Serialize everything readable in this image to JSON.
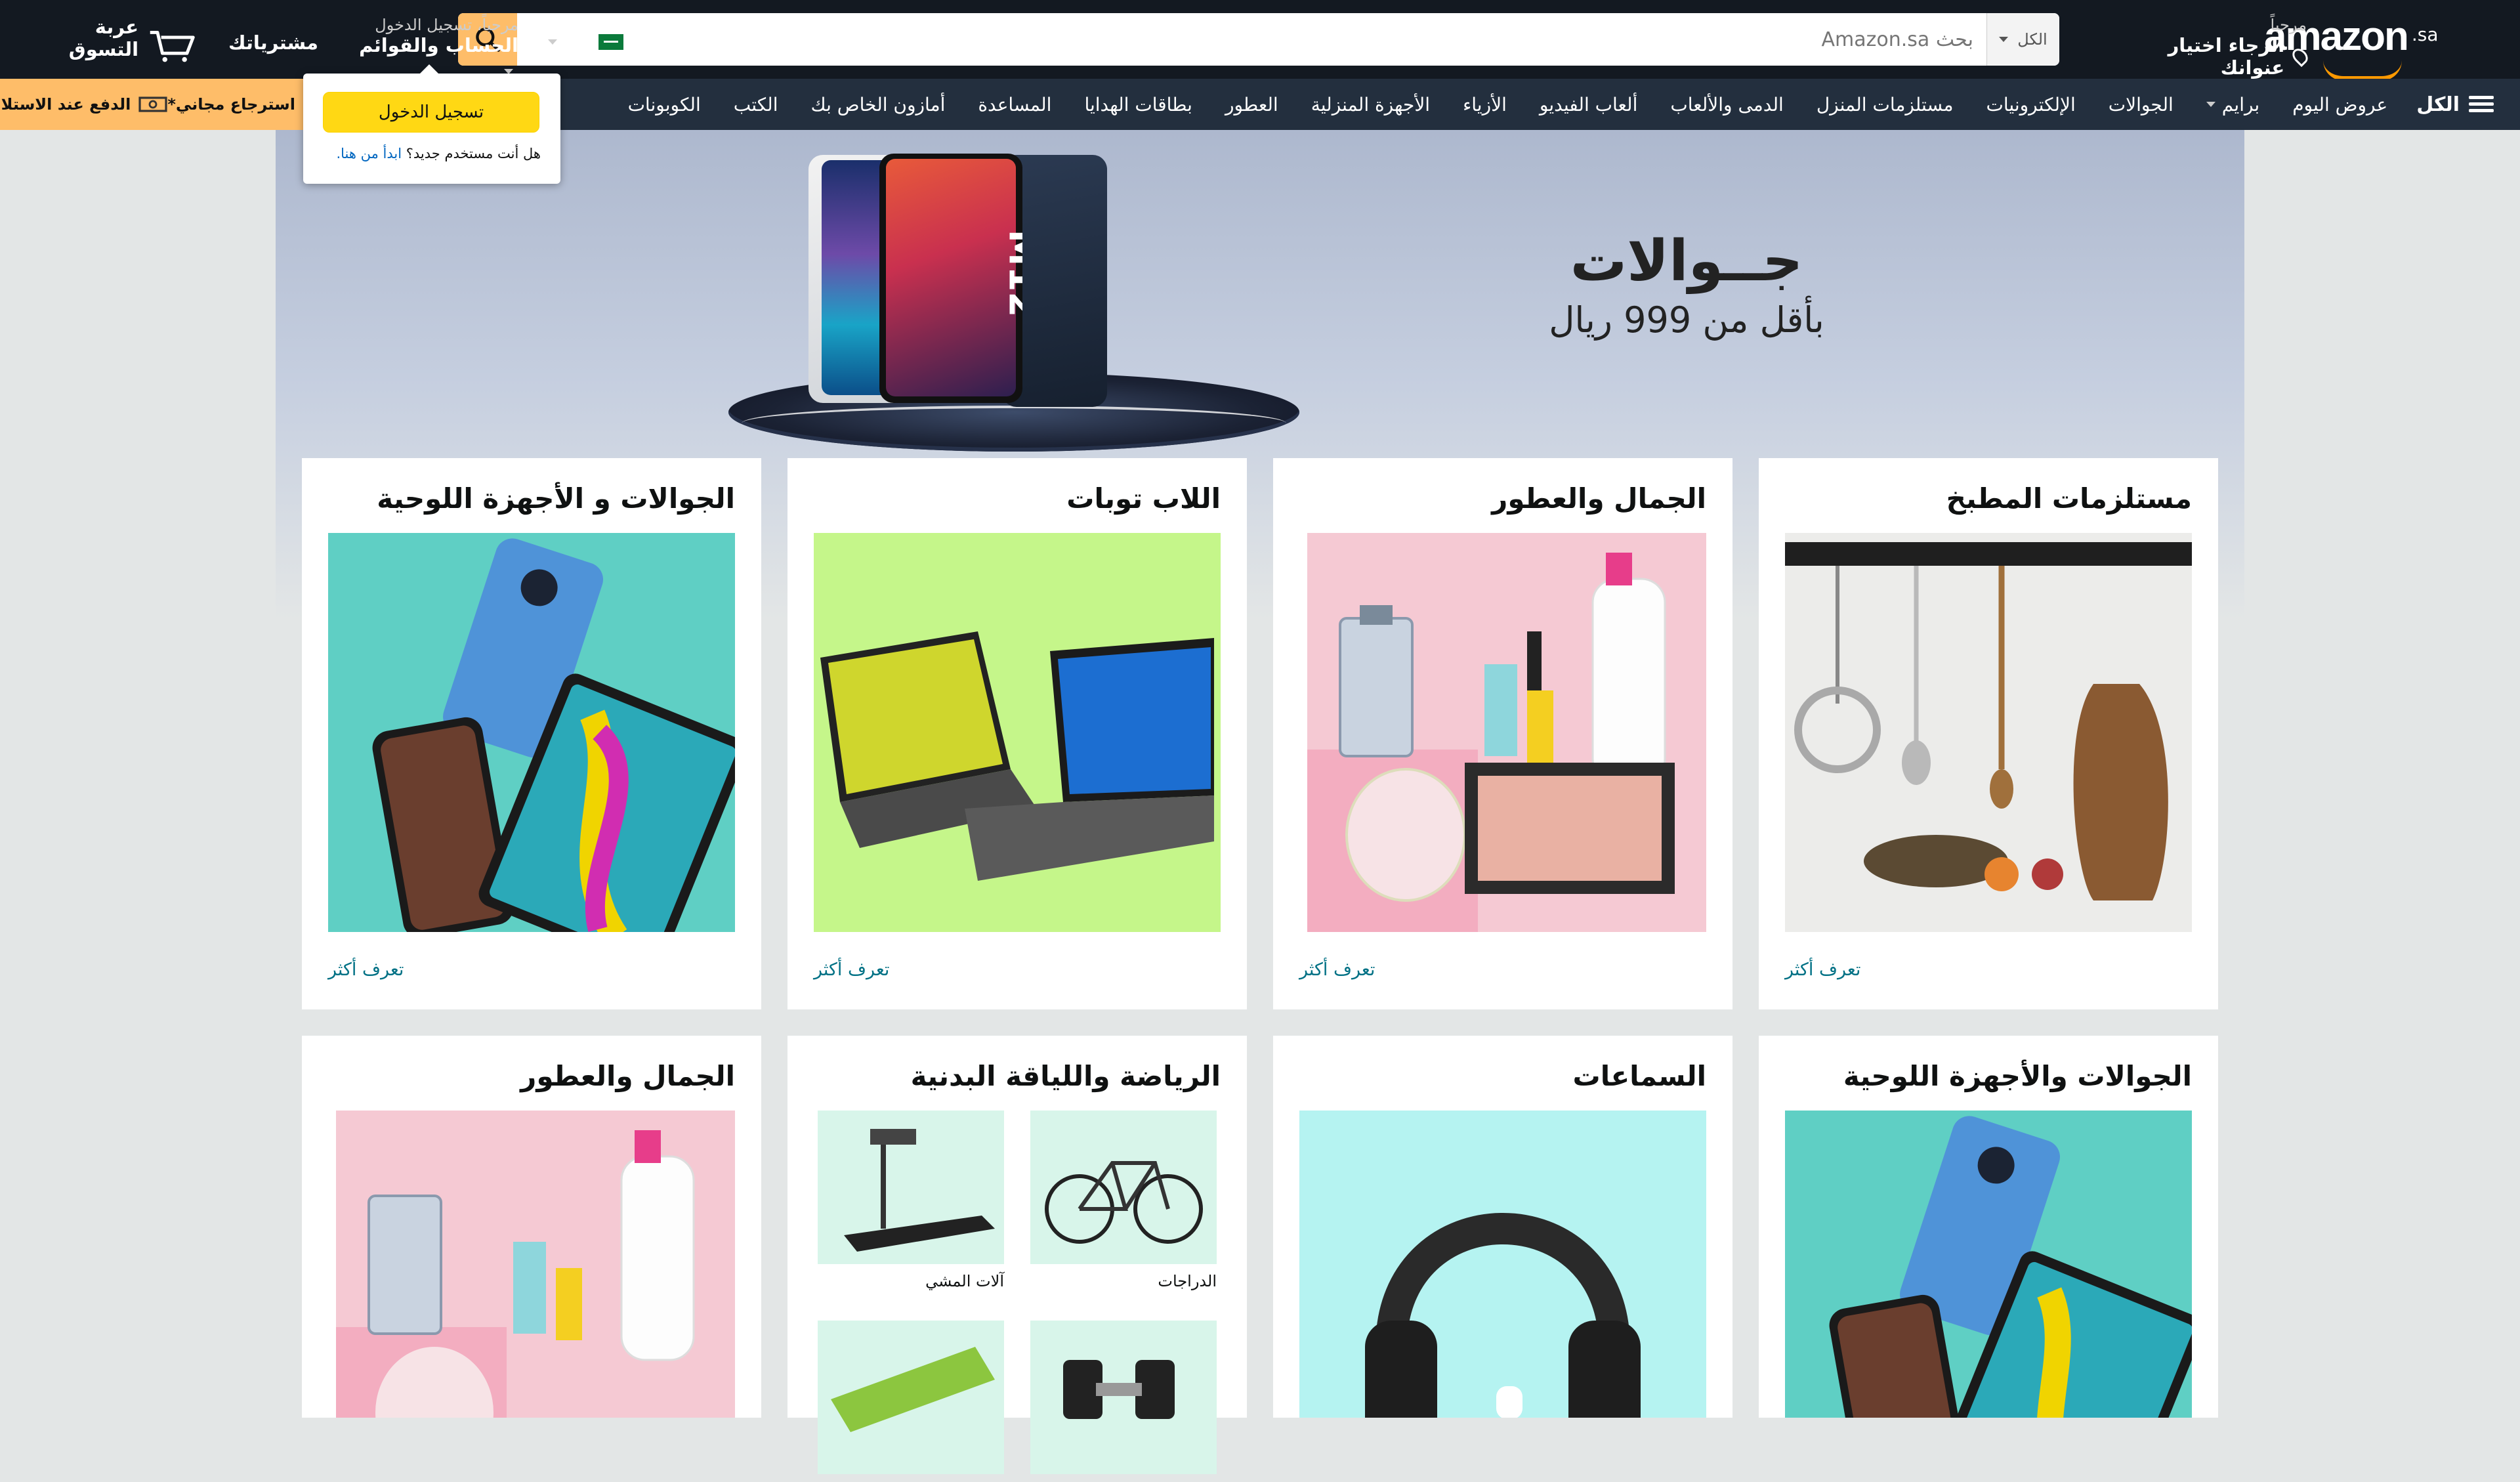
{
  "header": {
    "logo_text": "amazon",
    "logo_suffix": ".sa",
    "deliver_greeting": "مرحباً",
    "deliver_prompt": "الرجاء اختيار عنوانك",
    "search_category": "الكل",
    "search_placeholder": "بحث Amazon.sa",
    "language": "AR",
    "account_greeting": "مرحباً، تسجيل الدخول",
    "account_label": "الحساب والقوائم",
    "orders_label": "مشترياتك",
    "cart_label": "عربة التسوق"
  },
  "nav": {
    "all_label": "الكل",
    "items": [
      "عروض اليوم",
      "برايم",
      "الجوالات",
      "الإلكترونيات",
      "مستلزمات المنزل",
      "الدمى والألعاب",
      "ألعاب الفيديو",
      "الأزياء",
      "الأجهزة المنزلية",
      "العطور",
      "بطاقات الهدايا",
      "المساعدة",
      "أمازون الخاص بك",
      "الكتب",
      "الكوبونات"
    ]
  },
  "promo": {
    "returns": "استرجاع مجاني*",
    "cod": "الدفع عند الاستلام"
  },
  "signin_popover": {
    "button": "تسجيل الدخول",
    "new_user": "هل أنت مستخدم جديد؟",
    "start_here": "ابدأ من هنا."
  },
  "hero": {
    "title": "جــوالات",
    "subtitle": "بأقل من 999 ريال",
    "phone_model": "M12"
  },
  "cards_row1": [
    {
      "title": "مستلزمات المطبخ",
      "link": "تعرف أكثر"
    },
    {
      "title": "الجمال والعطور",
      "link": "تعرف أكثر"
    },
    {
      "title": "اللاب توبات",
      "link": "تعرف أكثر"
    },
    {
      "title": "الجوالات و الأجهزة اللوحية",
      "link": "تعرف أكثر"
    }
  ],
  "cards_row2": [
    {
      "title": "الجوالات والأجهزة اللوحية"
    },
    {
      "title": "السماعات"
    },
    {
      "title": "الرياضة واللياقة البدنية",
      "items": [
        "الدراجات",
        "آلات المشي",
        "",
        ""
      ]
    },
    {
      "title": "الجمال والعطور"
    }
  ],
  "colors": {
    "header_bg": "#131921",
    "nav_bg": "#232f3e",
    "accent": "#febd69",
    "signin_button": "#ffd814",
    "link": "#007185"
  }
}
